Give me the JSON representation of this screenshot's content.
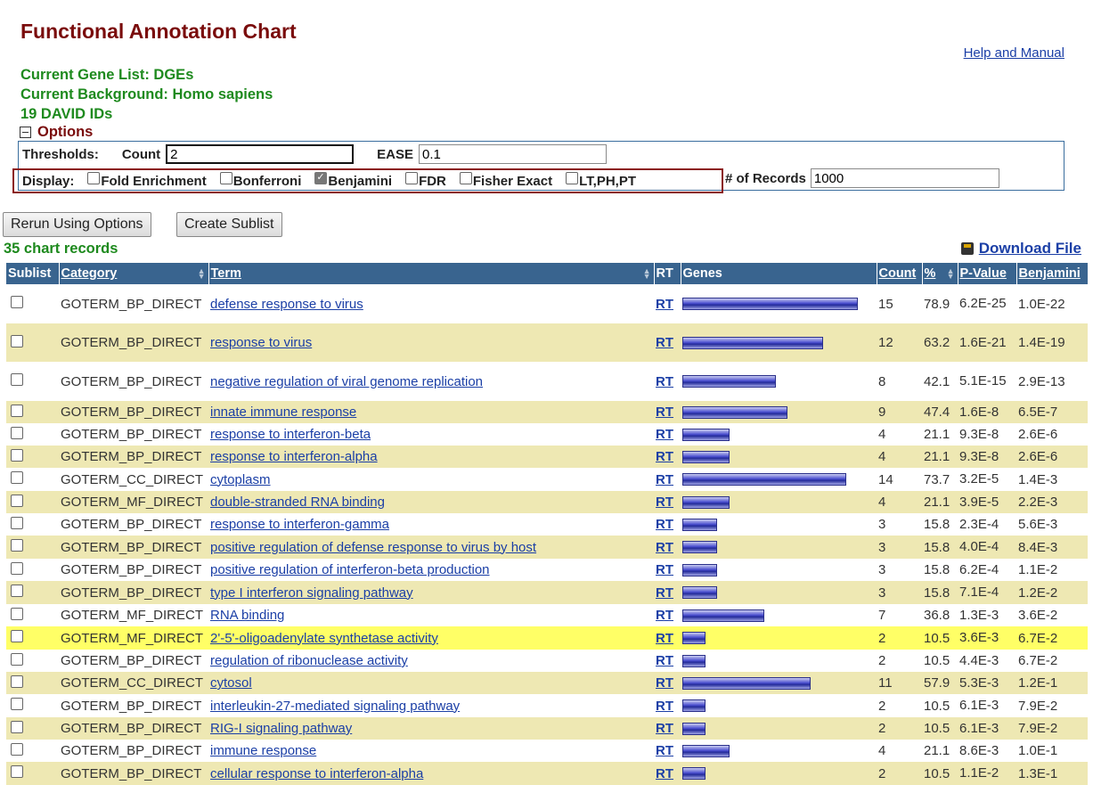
{
  "page": {
    "title": "Functional Annotation Chart",
    "help_link": "Help and Manual",
    "gene_list": "Current Gene List: DGEs",
    "background": "Current Background: Homo sapiens",
    "david_ids": "19 DAVID IDs"
  },
  "options": {
    "header": "Options",
    "thresholds_label": "Thresholds:",
    "count_label": "Count",
    "count_value": "2",
    "ease_label": "EASE",
    "ease_value": "0.1",
    "display_label": "Display:",
    "display_items": [
      {
        "label": "Fold Enrichment",
        "checked": false
      },
      {
        "label": "Bonferroni",
        "checked": false
      },
      {
        "label": "Benjamini",
        "checked": true
      },
      {
        "label": "FDR",
        "checked": false
      },
      {
        "label": "Fisher Exact",
        "checked": false
      },
      {
        "label": "LT,PH,PT",
        "checked": false
      }
    ],
    "records_label": "# of Records",
    "records_value": "1000"
  },
  "buttons": {
    "rerun": "Rerun Using Options",
    "sublist": "Create Sublist"
  },
  "summary": {
    "chart_records": "35 chart records",
    "download": "Download File"
  },
  "table": {
    "headers": {
      "sublist": "Sublist",
      "category": "Category",
      "term": "Term",
      "rt": "RT",
      "genes": "Genes",
      "count": "Count",
      "percent": "%",
      "pvalue": "P-Value",
      "benjamini": "Benjamini"
    },
    "rows": [
      {
        "category": "GOTERM_BP_DIRECT",
        "term": "defense response to virus",
        "rt": "RT",
        "count": "15",
        "percent": "78.9",
        "pvalue": "6.2E-25",
        "benjamini": "1.0E-22",
        "style": "white"
      },
      {
        "category": "GOTERM_BP_DIRECT",
        "term": "response to virus",
        "rt": "RT",
        "count": "12",
        "percent": "63.2",
        "pvalue": "1.6E-21",
        "benjamini": "1.4E-19",
        "style": "tan"
      },
      {
        "category": "GOTERM_BP_DIRECT",
        "term": "negative regulation of viral genome replication",
        "rt": "RT",
        "count": "8",
        "percent": "42.1",
        "pvalue": "5.1E-15",
        "benjamini": "2.9E-13",
        "style": "white"
      },
      {
        "category": "GOTERM_BP_DIRECT",
        "term": "innate immune response",
        "rt": "RT",
        "count": "9",
        "percent": "47.4",
        "pvalue": "1.6E-8",
        "benjamini": "6.5E-7",
        "style": "tan"
      },
      {
        "category": "GOTERM_BP_DIRECT",
        "term": "response to interferon-beta",
        "rt": "RT",
        "count": "4",
        "percent": "21.1",
        "pvalue": "9.3E-8",
        "benjamini": "2.6E-6",
        "style": "white"
      },
      {
        "category": "GOTERM_BP_DIRECT",
        "term": "response to interferon-alpha",
        "rt": "RT",
        "count": "4",
        "percent": "21.1",
        "pvalue": "9.3E-8",
        "benjamini": "2.6E-6",
        "style": "tan"
      },
      {
        "category": "GOTERM_CC_DIRECT",
        "term": "cytoplasm",
        "rt": "RT",
        "count": "14",
        "percent": "73.7",
        "pvalue": "3.2E-5",
        "benjamini": "1.4E-3",
        "style": "white"
      },
      {
        "category": "GOTERM_MF_DIRECT",
        "term": "double-stranded RNA binding",
        "rt": "RT",
        "count": "4",
        "percent": "21.1",
        "pvalue": "3.9E-5",
        "benjamini": "2.2E-3",
        "style": "tan"
      },
      {
        "category": "GOTERM_BP_DIRECT",
        "term": "response to interferon-gamma",
        "rt": "RT",
        "count": "3",
        "percent": "15.8",
        "pvalue": "2.3E-4",
        "benjamini": "5.6E-3",
        "style": "white"
      },
      {
        "category": "GOTERM_BP_DIRECT",
        "term": "positive regulation of defense response to virus by host",
        "rt": "RT",
        "count": "3",
        "percent": "15.8",
        "pvalue": "4.0E-4",
        "benjamini": "8.4E-3",
        "style": "tan"
      },
      {
        "category": "GOTERM_BP_DIRECT",
        "term": "positive regulation of interferon-beta production",
        "rt": "RT",
        "count": "3",
        "percent": "15.8",
        "pvalue": "6.2E-4",
        "benjamini": "1.1E-2",
        "style": "white"
      },
      {
        "category": "GOTERM_BP_DIRECT",
        "term": "type I interferon signaling pathway",
        "rt": "RT",
        "count": "3",
        "percent": "15.8",
        "pvalue": "7.1E-4",
        "benjamini": "1.2E-2",
        "style": "tan"
      },
      {
        "category": "GOTERM_MF_DIRECT",
        "term": "RNA binding",
        "rt": "RT",
        "count": "7",
        "percent": "36.8",
        "pvalue": "1.3E-3",
        "benjamini": "3.6E-2",
        "style": "white"
      },
      {
        "category": "GOTERM_MF_DIRECT",
        "term": "2'-5'-oligoadenylate synthetase activity",
        "rt": "RT",
        "count": "2",
        "percent": "10.5",
        "pvalue": "3.6E-3",
        "benjamini": "6.7E-2",
        "style": "yellow"
      },
      {
        "category": "GOTERM_BP_DIRECT",
        "term": "regulation of ribonuclease activity",
        "rt": "RT",
        "count": "2",
        "percent": "10.5",
        "pvalue": "4.4E-3",
        "benjamini": "6.7E-2",
        "style": "white"
      },
      {
        "category": "GOTERM_CC_DIRECT",
        "term": "cytosol",
        "rt": "RT",
        "count": "11",
        "percent": "57.9",
        "pvalue": "5.3E-3",
        "benjamini": "1.2E-1",
        "style": "tan"
      },
      {
        "category": "GOTERM_BP_DIRECT",
        "term": "interleukin-27-mediated signaling pathway",
        "rt": "RT",
        "count": "2",
        "percent": "10.5",
        "pvalue": "6.1E-3",
        "benjamini": "7.9E-2",
        "style": "white"
      },
      {
        "category": "GOTERM_BP_DIRECT",
        "term": "RIG-I signaling pathway",
        "rt": "RT",
        "count": "2",
        "percent": "10.5",
        "pvalue": "6.1E-3",
        "benjamini": "7.9E-2",
        "style": "tan"
      },
      {
        "category": "GOTERM_BP_DIRECT",
        "term": "immune response",
        "rt": "RT",
        "count": "4",
        "percent": "21.1",
        "pvalue": "8.6E-3",
        "benjamini": "1.0E-1",
        "style": "white"
      },
      {
        "category": "GOTERM_BP_DIRECT",
        "term": "cellular response to interferon-alpha",
        "rt": "RT",
        "count": "2",
        "percent": "10.5",
        "pvalue": "1.1E-2",
        "benjamini": "1.3E-1",
        "style": "tan"
      }
    ]
  }
}
